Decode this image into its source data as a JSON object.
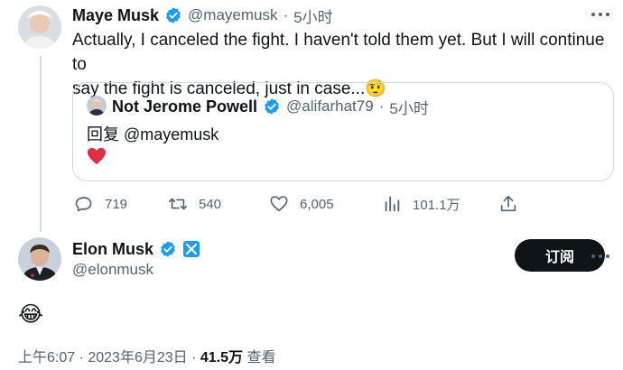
{
  "tweet1": {
    "name": "Maye Musk",
    "handle": "@mayemusk",
    "separator": "·",
    "time": "5小时",
    "text_line1": "Actually, I canceled the fight. I haven't told them yet. But I will continue to",
    "text_line2": "say the fight is canceled, just in case...",
    "emoji": "🤨"
  },
  "quote": {
    "name": "Not Jerome Powell",
    "handle": "@alifarhat79",
    "separator": "·",
    "time": "5小时",
    "reply_prefix": "回复",
    "reply_handle": "@mayemusk",
    "heart": "❤️"
  },
  "actions": {
    "replies": "719",
    "retweets": "540",
    "likes": "6,005",
    "views": "101.1万"
  },
  "tweet2": {
    "name": "Elon Musk",
    "handle": "@elonmusk",
    "follow_label": "订阅",
    "text": "😂",
    "timestamp": "上午6:07 · 2023年6月23日 · ",
    "views_count": "41.5万",
    "views_label": " 查看"
  },
  "colors": {
    "verified_blue": "#1d9bf0",
    "text_primary": "#0f1419",
    "text_secondary": "#536471",
    "border": "#cfd9de"
  }
}
